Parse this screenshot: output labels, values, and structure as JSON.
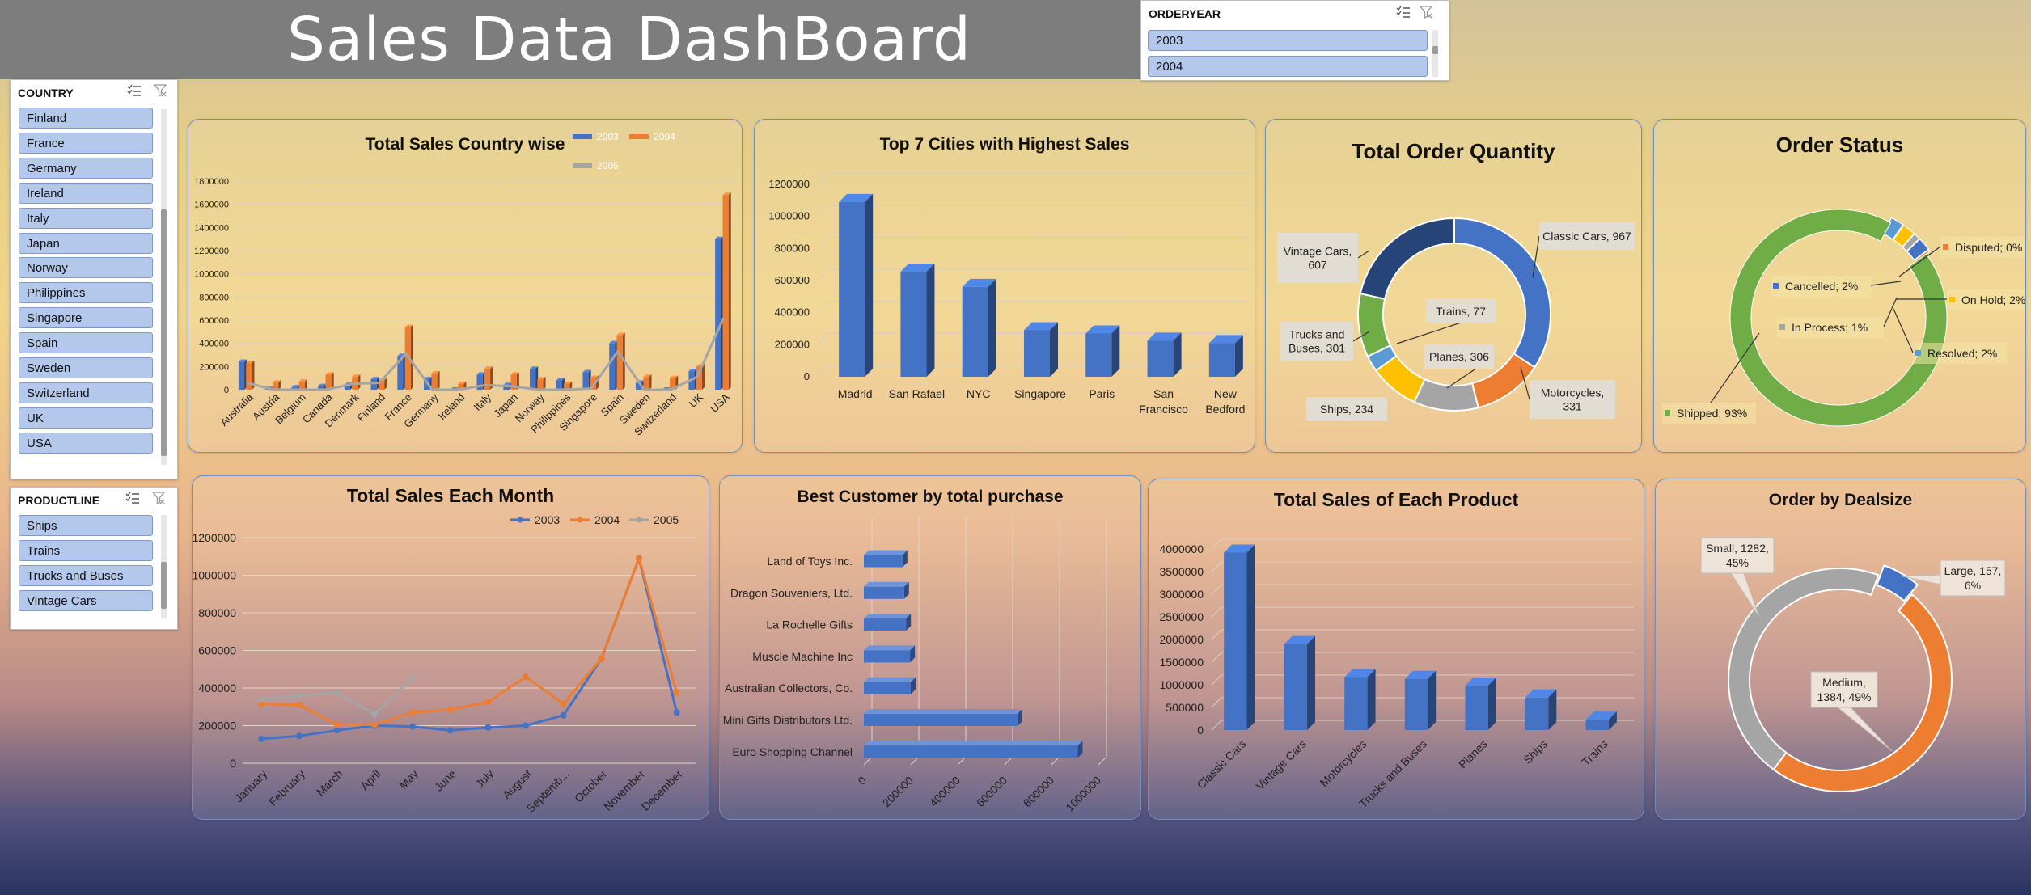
{
  "header": {
    "title": "Sales Data DashBoard"
  },
  "slicers": {
    "orderyear": {
      "title": "ORDERYEAR",
      "items": [
        "2003",
        "2004"
      ]
    },
    "country": {
      "title": "COUNTRY",
      "items": [
        "Finland",
        "France",
        "Germany",
        "Ireland",
        "Italy",
        "Japan",
        "Norway",
        "Philippines",
        "Singapore",
        "Spain",
        "Sweden",
        "Switzerland",
        "UK",
        "USA"
      ]
    },
    "productline": {
      "title": "PRODUCTLINE",
      "items": [
        "Ships",
        "Trains",
        "Trucks and Buses",
        "Vintage Cars"
      ]
    }
  },
  "colors": {
    "c2003": "#4472c4",
    "c2004": "#ed7d31",
    "c2005": "#a5a5a5",
    "green": "#70ad47",
    "gold": "#ffc000"
  },
  "charts": {
    "country": {
      "title": "Total Sales Country wise",
      "chart_data": {
        "type": "bar",
        "categories": [
          "Australia",
          "Austria",
          "Belgium",
          "Canada",
          "Denmark",
          "Finland",
          "France",
          "Germany",
          "Ireland",
          "Italy",
          "Japan",
          "Norway",
          "Philippines",
          "Singapore",
          "Spain",
          "Sweden",
          "Switzerland",
          "UK",
          "USA"
        ],
        "series": [
          {
            "name": "2003",
            "values": [
              240000,
              5000,
              20000,
              30000,
              40000,
              90000,
              290000,
              90000,
              0,
              130000,
              40000,
              180000,
              80000,
              150000,
              400000,
              60000,
              0,
              160000,
              1300000
            ]
          },
          {
            "name": "2004",
            "values": [
              230000,
              60000,
              70000,
              130000,
              110000,
              80000,
              540000,
              140000,
              50000,
              180000,
              130000,
              90000,
              50000,
              100000,
              470000,
              110000,
              100000,
              200000,
              1680000
            ]
          },
          {
            "name": "2005",
            "values": [
              60000,
              0,
              0,
              0,
              50000,
              60000,
              310000,
              0,
              0,
              40000,
              30000,
              0,
              0,
              10000,
              330000,
              0,
              0,
              110000,
              620000
            ]
          }
        ],
        "ylim": [
          0,
          1800000
        ],
        "yticks": [
          "0",
          "200000",
          "400000",
          "600000",
          "800000",
          "1000000",
          "1200000",
          "1400000",
          "1600000",
          "1800000"
        ],
        "legend": [
          "2003",
          "2004",
          "2005"
        ]
      }
    },
    "cities": {
      "title": "Top 7 Cities with Highest Sales",
      "chart_data": {
        "type": "bar",
        "categories": [
          "Madrid",
          "San Rafael",
          "NYC",
          "Singapore",
          "Paris",
          "San Francisco",
          "New Bedford"
        ],
        "catLines": [
          [
            "Madrid"
          ],
          [
            "San Rafael"
          ],
          [
            "NYC"
          ],
          [
            "Singapore"
          ],
          [
            "Paris"
          ],
          [
            "San",
            "Francisco"
          ],
          [
            "New",
            "Bedford"
          ]
        ],
        "values": [
          1090000,
          655000,
          560000,
          290000,
          270000,
          225000,
          210000
        ],
        "ylim": [
          0,
          1200000
        ],
        "yticks": [
          "0",
          "200000",
          "400000",
          "600000",
          "800000",
          "1000000",
          "1200000"
        ]
      }
    },
    "quantity": {
      "title": "Total Order Quantity",
      "chart_data": {
        "type": "pie",
        "labels": [
          "Classic Cars",
          "Motorcycles",
          "Planes",
          "Ships",
          "Trains",
          "Trucks and Buses",
          "Vintage Cars"
        ],
        "values": [
          967,
          331,
          306,
          234,
          77,
          301,
          607
        ],
        "data_labels": [
          [
            "Classic Cars, 967"
          ],
          [
            "Motorcycles,",
            "331"
          ],
          [
            "Planes, 306"
          ],
          [
            "Ships, 234"
          ],
          [
            "Trains, 77"
          ],
          [
            "Trucks and",
            "Buses, 301"
          ],
          [
            "Vintage Cars,",
            "607"
          ]
        ]
      }
    },
    "status": {
      "title": "Order Status",
      "chart_data": {
        "type": "pie",
        "labels": [
          "Shipped",
          "Resolved",
          "On Hold",
          "In Process",
          "Cancelled",
          "Disputed"
        ],
        "values": [
          93,
          2,
          2,
          1,
          2,
          0
        ],
        "data_labels": [
          "Shipped; 93%",
          "Resolved; 2%",
          "On Hold; 2%",
          "In Process; 1%",
          "Cancelled; 2%",
          "Disputed; 0%"
        ]
      }
    },
    "monthly": {
      "title": "Total Sales Each Month",
      "chart_data": {
        "type": "line",
        "categories": [
          "January",
          "February",
          "March",
          "April",
          "May",
          "June",
          "July",
          "August",
          "Septemb...",
          "October",
          "November",
          "December"
        ],
        "series": [
          {
            "name": "2003",
            "values": [
              130000,
              145000,
              175000,
              200000,
              195000,
              175000,
              190000,
              200000,
              255000,
              555000,
              1090000,
              270000
            ]
          },
          {
            "name": "2004",
            "values": [
              315000,
              310000,
              205000,
              205000,
              270000,
              285000,
              325000,
              460000,
              315000,
              555000,
              1090000,
              375000
            ]
          },
          {
            "name": "2005",
            "values": [
              340000,
              360000,
              375000,
              260000,
              455000
            ]
          }
        ],
        "ylim": [
          0,
          1200000
        ],
        "yticks": [
          "0",
          "200000",
          "400000",
          "600000",
          "800000",
          "1000000",
          "1200000"
        ],
        "legend": [
          "2003",
          "2004",
          "2005"
        ]
      }
    },
    "customers": {
      "title": "Best Customer by total purchase",
      "chart_data": {
        "type": "bar",
        "orientation": "horizontal",
        "categories": [
          "Land of Toys Inc.",
          "Dragon Souveniers, Ltd.",
          "La Rochelle Gifts",
          "Muscle Machine Inc",
          "Australian Collectors, Co.",
          "Mini Gifts Distributors Ltd.",
          "Euro Shopping Channel"
        ],
        "values": [
          165000,
          172000,
          180000,
          197000,
          200000,
          655000,
          912000
        ],
        "xlim": [
          0,
          1000000
        ],
        "xticks": [
          "0",
          "200000",
          "400000",
          "600000",
          "800000",
          "1000000"
        ]
      }
    },
    "products": {
      "title": "Total Sales of Each Product",
      "chart_data": {
        "type": "bar",
        "categories": [
          "Classic Cars",
          "Vintage Cars",
          "Motorcycles",
          "Trucks and Buses",
          "Planes",
          "Ships",
          "Trains"
        ],
        "values": [
          3920000,
          1900000,
          1170000,
          1130000,
          980000,
          720000,
          230000
        ],
        "ylim": [
          0,
          4000000
        ],
        "yticks": [
          "0",
          "500000",
          "1000000",
          "1500000",
          "2000000",
          "2500000",
          "3000000",
          "3500000",
          "4000000"
        ]
      }
    },
    "dealsize": {
      "title": "Order by Dealsize",
      "chart_data": {
        "type": "pie",
        "labels": [
          "Large",
          "Medium",
          "Small"
        ],
        "values": [
          157,
          1384,
          1282
        ],
        "data_labels": [
          [
            "Large, 157,",
            "6%"
          ],
          [
            "Medium,",
            "1384, 49%"
          ],
          [
            "Small, 1282,",
            "45%"
          ]
        ]
      }
    }
  }
}
